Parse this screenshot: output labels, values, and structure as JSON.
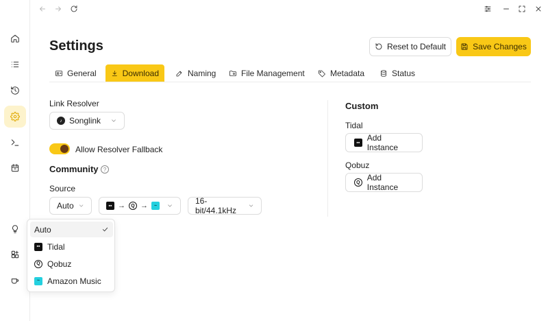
{
  "sidebar": {
    "items": [
      {
        "icon": "home-icon"
      },
      {
        "icon": "list-icon"
      },
      {
        "icon": "history-icon"
      },
      {
        "icon": "gear-icon",
        "active": true
      },
      {
        "icon": "terminal-icon"
      },
      {
        "icon": "calendar-icon"
      },
      {
        "icon": "lightbulb-icon"
      },
      {
        "icon": "puzzle-icon"
      },
      {
        "icon": "coffee-icon"
      }
    ]
  },
  "page": {
    "title": "Settings",
    "reset_label": "Reset to Default",
    "save_label": "Save Changes"
  },
  "tabs": [
    {
      "label": "General",
      "icon": "user-card-icon"
    },
    {
      "label": "Download",
      "icon": "download-icon",
      "active": true
    },
    {
      "label": "Naming",
      "icon": "edit-icon"
    },
    {
      "label": "File Management",
      "icon": "folder-gear-icon"
    },
    {
      "label": "Metadata",
      "icon": "tag-icon"
    },
    {
      "label": "Status",
      "icon": "stack-icon"
    }
  ],
  "link_resolver": {
    "label": "Link Resolver",
    "value": "Songlink",
    "fallback_label": "Allow Resolver Fallback",
    "fallback_on": true
  },
  "community": {
    "title": "Community",
    "source_label": "Source",
    "source_value": "Auto",
    "quality_value": "16-bit/44.1kHz"
  },
  "custom": {
    "title": "Custom",
    "tidal_label": "Tidal",
    "qobuz_label": "Qobuz",
    "add_instance_label": "Add Instance"
  },
  "dropdown": {
    "options": [
      "Auto",
      "Tidal",
      "Qobuz",
      "Amazon Music"
    ],
    "selected": "Auto"
  },
  "colors": {
    "accent": "#f9c816",
    "accent_text": "#3a2c00",
    "toggle_knob": "#6b3b12",
    "amazon": "#24d0df"
  }
}
